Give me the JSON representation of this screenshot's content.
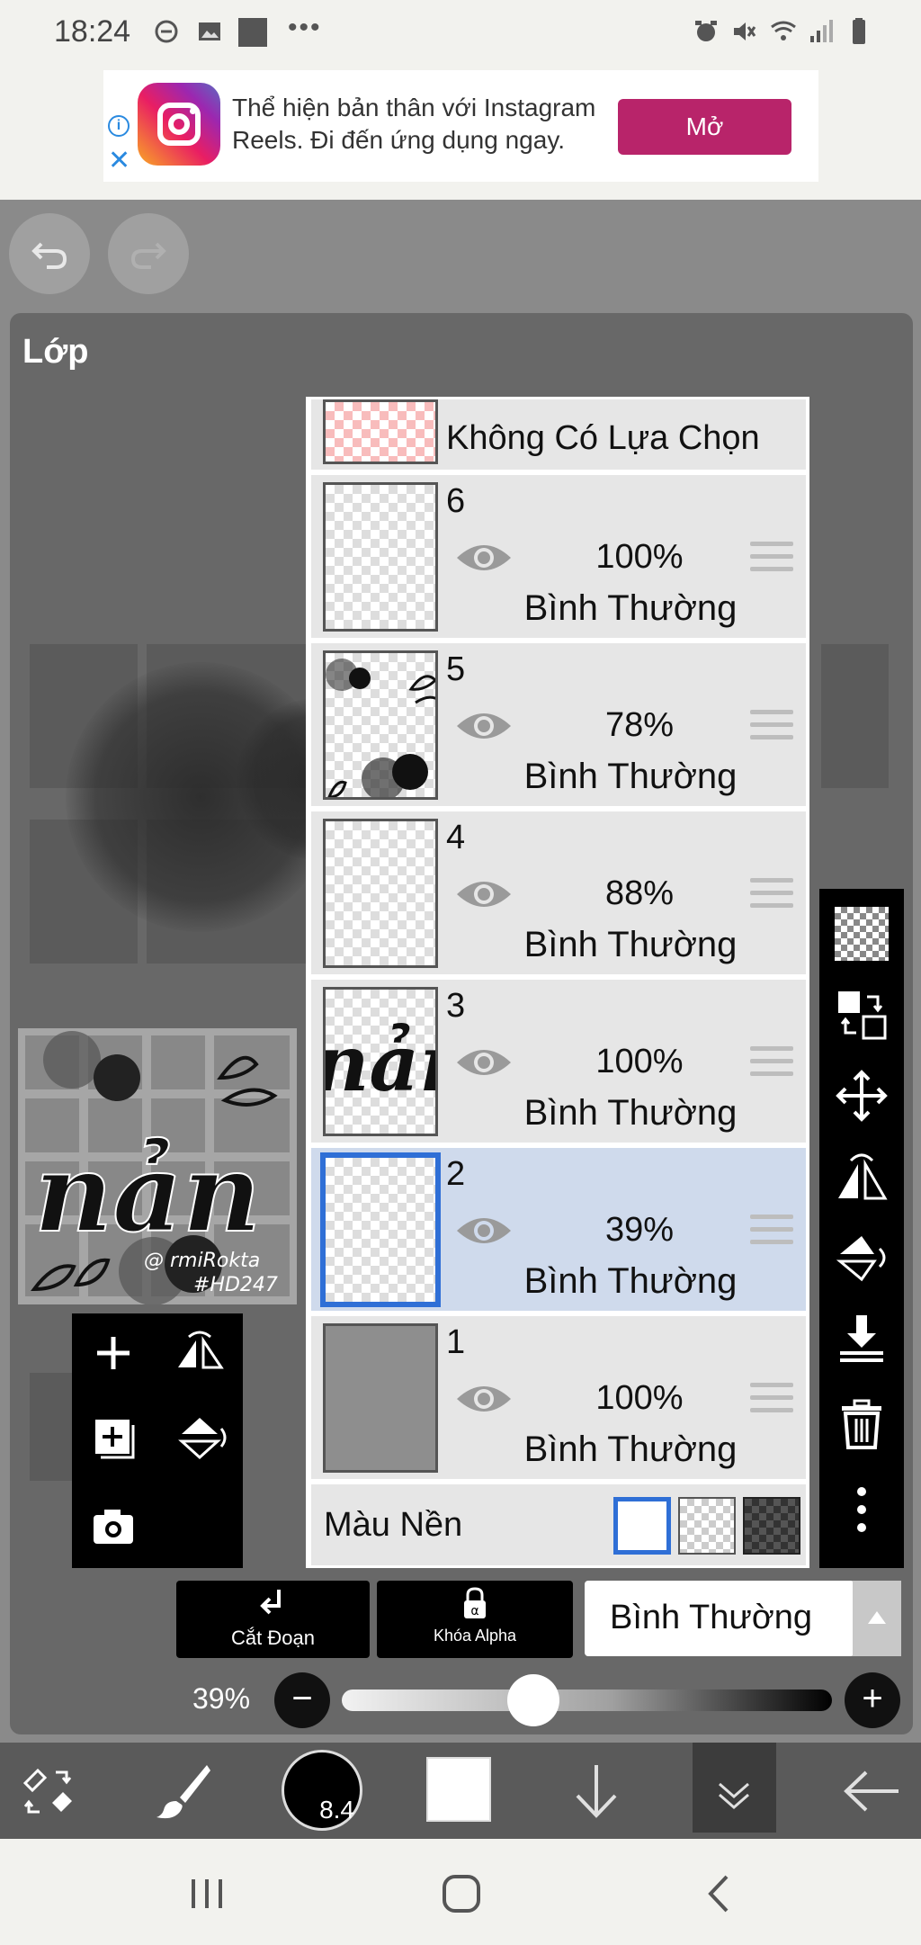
{
  "status_bar": {
    "time": "18:24",
    "left_icons": [
      "do-not-disturb-icon",
      "image-icon",
      "square-icon",
      "more-icon"
    ],
    "right_icons": [
      "alarm-icon",
      "mute-icon",
      "wifi-icon",
      "signal-icon",
      "battery-icon"
    ]
  },
  "ad": {
    "line1": "Thể hiện bản thân với Instagram",
    "line2": "Reels. Đi đến ứng dụng ngay.",
    "button": "Mở",
    "icon": "instagram-logo"
  },
  "panel": {
    "title": "Lớp"
  },
  "selection_layer": {
    "label": "Không Có Lựa Chọn"
  },
  "layers": [
    {
      "number": "6",
      "opacity": "100%",
      "mode": "Bình Thường",
      "selected": false
    },
    {
      "number": "5",
      "opacity": "78%",
      "mode": "Bình Thường",
      "selected": false
    },
    {
      "number": "4",
      "opacity": "88%",
      "mode": "Bình Thường",
      "selected": false
    },
    {
      "number": "3",
      "opacity": "100%",
      "mode": "Bình Thường",
      "selected": false
    },
    {
      "number": "2",
      "opacity": "39%",
      "mode": "Bình Thường",
      "selected": true
    },
    {
      "number": "1",
      "opacity": "100%",
      "mode": "Bình Thường",
      "selected": false
    }
  ],
  "background_color": {
    "label": "Màu Nền",
    "options": [
      "white",
      "transparent",
      "dark-checker"
    ],
    "selected": "white"
  },
  "controls": {
    "clipping": "Cắt Đoạn",
    "alpha_lock": "Khóa Alpha",
    "blend_mode": "Bình Thường",
    "opacity_label": "39%",
    "opacity_value": 0.39
  },
  "brush": {
    "size": "8.4"
  },
  "thumbnail": {
    "text": "nản",
    "watermark1": "@ rmiRokta",
    "watermark2": "#HD247"
  },
  "colors": {
    "accent_blue": "#2f6fd6",
    "ad_button": "#b8246a",
    "selected_row": "#cfdaec"
  }
}
